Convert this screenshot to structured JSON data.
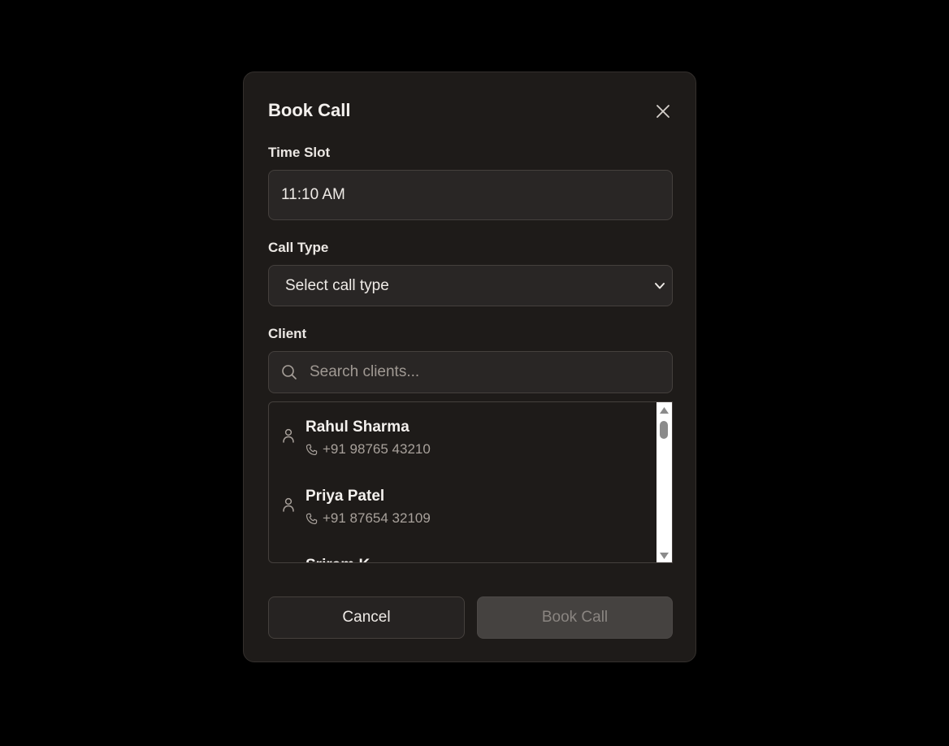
{
  "dialog": {
    "title": "Book Call",
    "time_slot": {
      "label": "Time Slot",
      "value": "11:10 AM"
    },
    "call_type": {
      "label": "Call Type",
      "selected": "Select call type"
    },
    "client": {
      "label": "Client",
      "search_placeholder": "Search clients...",
      "items": [
        {
          "name": "Rahul Sharma",
          "phone": "+91 98765 43210"
        },
        {
          "name": "Priya Patel",
          "phone": "+91 87654 32109"
        },
        {
          "name": "Sriram K",
          "phone": ""
        }
      ]
    },
    "buttons": {
      "cancel": "Cancel",
      "book": "Book Call"
    }
  },
  "colors": {
    "background": "#000000",
    "dialog_bg": "#1e1b19",
    "field_bg": "#292625",
    "disabled_button_bg": "#454240"
  },
  "icons": [
    "close-icon",
    "search-icon",
    "person-icon",
    "phone-icon",
    "chevron-down-icon"
  ]
}
